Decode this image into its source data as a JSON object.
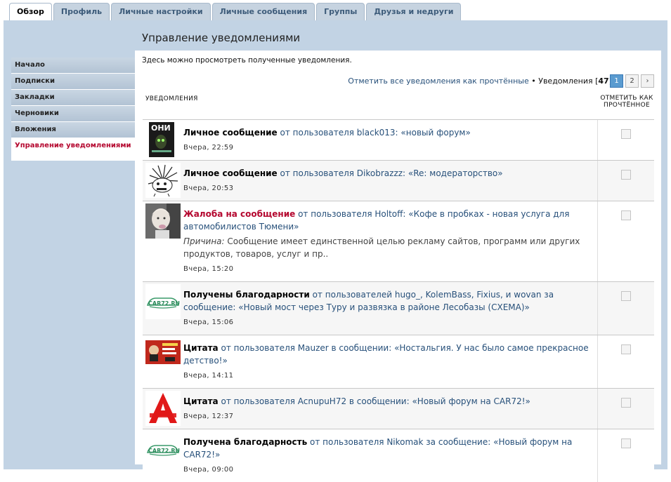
{
  "tabs": [
    "Обзор",
    "Профиль",
    "Личные настройки",
    "Личные сообщения",
    "Группы",
    "Друзья и недруги"
  ],
  "panel_title": "Управление уведомлениями",
  "sidebar": [
    "Начало",
    "Подписки",
    "Закладки",
    "Черновики",
    "Вложения",
    "Управление уведомлениями"
  ],
  "description": "Здесь можно просмотреть полученные уведомления.",
  "mark_all_label": "Отметить все уведомления как прочтённые",
  "separator": "•",
  "count_label": "Уведомления [",
  "count": "47",
  "count_close": "]",
  "pages": [
    "1",
    "2",
    "›"
  ],
  "columns": {
    "notifications": "УВЕДОМЛЕНИЯ",
    "mark_read": "ОТМЕТИТЬ КАК ПРОЧТЁННОЕ"
  },
  "notifications": [
    {
      "kind": "Личное сообщение",
      "text": " от пользователя black013: «новый форум»",
      "time": "Вчера, 22:59",
      "avatar": "dark-poster"
    },
    {
      "kind": "Личное сообщение",
      "text": " от пользователя Dikobrazzz: «Re: модераторство»",
      "time": "Вчера, 20:53",
      "avatar": "hedgehog-sketch"
    },
    {
      "kind": "Жалоба на сообщение",
      "red": true,
      "text": " от пользователя Holtoff: «Кофе в пробках - новая услуга для автомобилистов Тюмени»",
      "reason_label": "Причина:",
      "reason": " Сообщение имеет единственной целью рекламу сайтов, программ или других продуктов, товаров, услуг и пр..",
      "time": "Вчера, 15:20",
      "avatar": "child-photo"
    },
    {
      "kind": "Получены благодарности",
      "text": " от пользователей hugo_, KolemBass, Fixius, и wovan за сообщение: «Новый мост через Туру и развязка в районе Лесобазы (СХЕМА)»",
      "time": "Вчера, 15:06",
      "avatar": "car72-logo"
    },
    {
      "kind": "Цитата",
      "text": " от пользователя Mauzer в сообщении: «Ностальгия. У нас было самое прекрасное детство!»",
      "time": "Вчера, 14:11",
      "avatar": "red-poster"
    },
    {
      "kind": "Цитата",
      "text": " от пользователя AcnupuH72 в сообщении: «Новый форум на CAR72!»",
      "time": "Вчера, 12:37",
      "avatar": "red-a-logo"
    },
    {
      "kind": "Получена благодарность",
      "text": " от пользователя Nikomak за сообщение: «Новый форум на CAR72!»",
      "time": "Вчера, 09:00",
      "avatar": "car72-logo"
    }
  ],
  "car72_text": "CAR72.RU",
  "poster_text": "ОНИ"
}
